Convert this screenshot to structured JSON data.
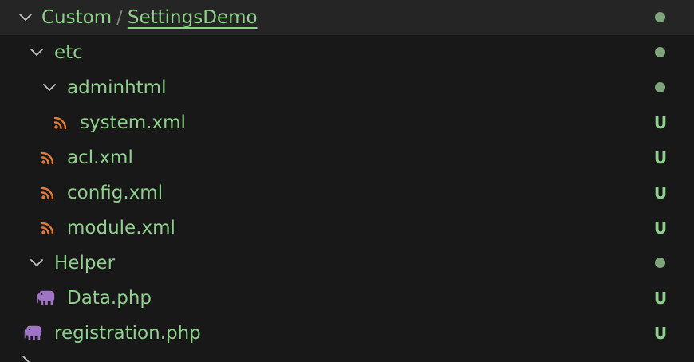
{
  "colors": {
    "background": "#181818",
    "header_background": "#252526",
    "untracked_text": "#8fd08c",
    "xml_icon": "#e37933",
    "php_icon": "#a074c4",
    "chevron": "#c5c5c5",
    "dot": "#7fa37a"
  },
  "header": {
    "parent": "Custom",
    "separator": "/",
    "leaf": "SettingsDemo"
  },
  "tree": [
    {
      "id": "etc",
      "label": "etc",
      "type": "folder",
      "expanded": true,
      "status": "dot"
    },
    {
      "id": "adminhtml",
      "label": "adminhtml",
      "type": "folder",
      "expanded": true,
      "status": "dot"
    },
    {
      "id": "system-xml",
      "label": "system.xml",
      "type": "xml",
      "icon": "rss-icon",
      "status": "U"
    },
    {
      "id": "acl-xml",
      "label": "acl.xml",
      "type": "xml",
      "icon": "rss-icon",
      "status": "U"
    },
    {
      "id": "config-xml",
      "label": "config.xml",
      "type": "xml",
      "icon": "rss-icon",
      "status": "U"
    },
    {
      "id": "module-xml",
      "label": "module.xml",
      "type": "xml",
      "icon": "rss-icon",
      "status": "U"
    },
    {
      "id": "helper",
      "label": "Helper",
      "type": "folder",
      "expanded": true,
      "status": "dot"
    },
    {
      "id": "data-php",
      "label": "Data.php",
      "type": "php",
      "icon": "elephant-icon",
      "status": "U"
    },
    {
      "id": "registration-php",
      "label": "registration.php",
      "type": "php",
      "icon": "elephant-icon",
      "status": "U"
    }
  ]
}
